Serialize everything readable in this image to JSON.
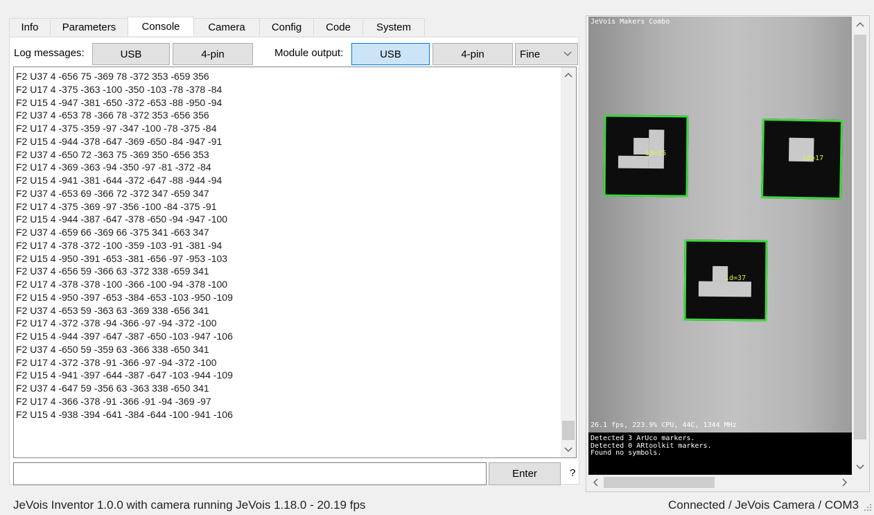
{
  "tabs": [
    {
      "label": "Info"
    },
    {
      "label": "Parameters"
    },
    {
      "label": "Console",
      "active": true
    },
    {
      "label": "Camera"
    },
    {
      "label": "Config"
    },
    {
      "label": "Code"
    },
    {
      "label": "System"
    }
  ],
  "controls": {
    "log_label": "Log messages:",
    "log_usb": "USB",
    "log_4pin": "4-pin",
    "module_label": "Module output:",
    "module_usb": "USB",
    "module_4pin": "4-pin",
    "level_selected": "Fine",
    "enter_label": "Enter",
    "help_label": "?"
  },
  "command_input": {
    "value": "",
    "placeholder": ""
  },
  "log_lines": [
    "F2 U37 4 -656 75 -369 78 -372 353 -659 356",
    "F2 U17 4 -375 -363 -100 -350 -103 -78 -378 -84",
    "F2 U15 4 -947 -381 -650 -372 -653 -88 -950 -94",
    "F2 U37 4 -653 78 -366 78 -372 353 -656 356",
    "F2 U17 4 -375 -359 -97 -347 -100 -78 -375 -84",
    "F2 U15 4 -944 -378 -647 -369 -650 -84 -947 -91",
    "F2 U37 4 -650 72 -363 75 -369 350 -656 353",
    "F2 U17 4 -369 -363 -94 -350 -97 -81 -372 -84",
    "F2 U15 4 -941 -381 -644 -372 -647 -88 -944 -94",
    "F2 U37 4 -653 69 -366 72 -372 347 -659 347",
    "F2 U17 4 -375 -369 -97 -356 -100 -84 -375 -91",
    "F2 U15 4 -944 -387 -647 -378 -650 -94 -947 -100",
    "F2 U37 4 -659 66 -369 66 -375 341 -663 347",
    "F2 U17 4 -378 -372 -100 -359 -103 -91 -381 -94",
    "F2 U15 4 -950 -391 -653 -381 -656 -97 -953 -103",
    "F2 U37 4 -656 59 -366 63 -372 338 -659 341",
    "F2 U17 4 -378 -378 -100 -366 -100 -94 -378 -100",
    "F2 U15 4 -950 -397 -653 -384 -653 -103 -950 -109",
    "F2 U37 4 -653 59 -363 63 -369 338 -656 341",
    "F2 U17 4 -372 -378 -94 -366 -97 -94 -372 -100",
    "F2 U15 4 -944 -397 -647 -387 -650 -103 -947 -106",
    "F2 U37 4 -650 59 -359 63 -366 338 -650 341",
    "F2 U17 4 -372 -378 -91 -366 -97 -94 -372 -100",
    "F2 U15 4 -941 -397 -644 -387 -647 -103 -944 -109",
    "F2 U37 4 -647 59 -356 63 -363 338 -650 341",
    "F2 U17 4 -366 -378 -91 -366 -91 -94 -369 -97",
    "F2 U15 4 -938 -394 -641 -384 -644 -100 -941 -106"
  ],
  "log_text": "",
  "video": {
    "title": "JeVois Makers Combo",
    "fps_line": "26.1 fps, 223.9% CPU, 44C, 1344 MHz",
    "messages": "Detected 3 ArUco markers.\nDetected 0 ARtoolkit markers.\nFound no symbols.",
    "markers": [
      {
        "label": "id=15"
      },
      {
        "label": "id=17"
      },
      {
        "label": "id=37"
      }
    ]
  },
  "status": {
    "left": "JeVois Inventor 1.0.0 with camera running JeVois 1.18.0 - 20.19 fps",
    "right": "Connected / JeVois Camera / COM3"
  },
  "colors": {
    "accent": "#0078d7",
    "selected_button": "#cce4f7",
    "marker_border": "#3ed83e"
  }
}
